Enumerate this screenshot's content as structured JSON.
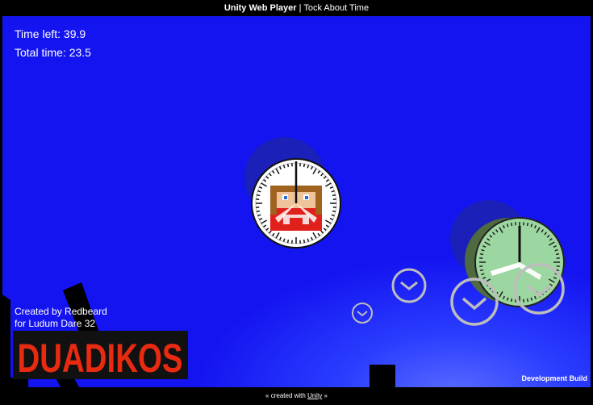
{
  "window": {
    "app_name": "Unity Web Player",
    "separator": " | ",
    "page_title": "Tock About Time"
  },
  "hud": {
    "time_left_label": "Time left: 39.9",
    "total_time_label": "Total time: 23.5"
  },
  "credits": {
    "line1": "Created by Redbeard",
    "line2": "for Ludum Dare 32"
  },
  "logo": {
    "text": "DUADIKOS",
    "fill_color": "#e82a10"
  },
  "build": {
    "label": "Development Build"
  },
  "footer": {
    "prefix": "« created with ",
    "link": "Unity",
    "suffix": " »"
  },
  "colors": {
    "sky": "#1414f0",
    "player_clock_face": "#ffffff",
    "goal_clock_face": "#9cd6a0",
    "small_clock_ring": "#bdbdbd"
  }
}
